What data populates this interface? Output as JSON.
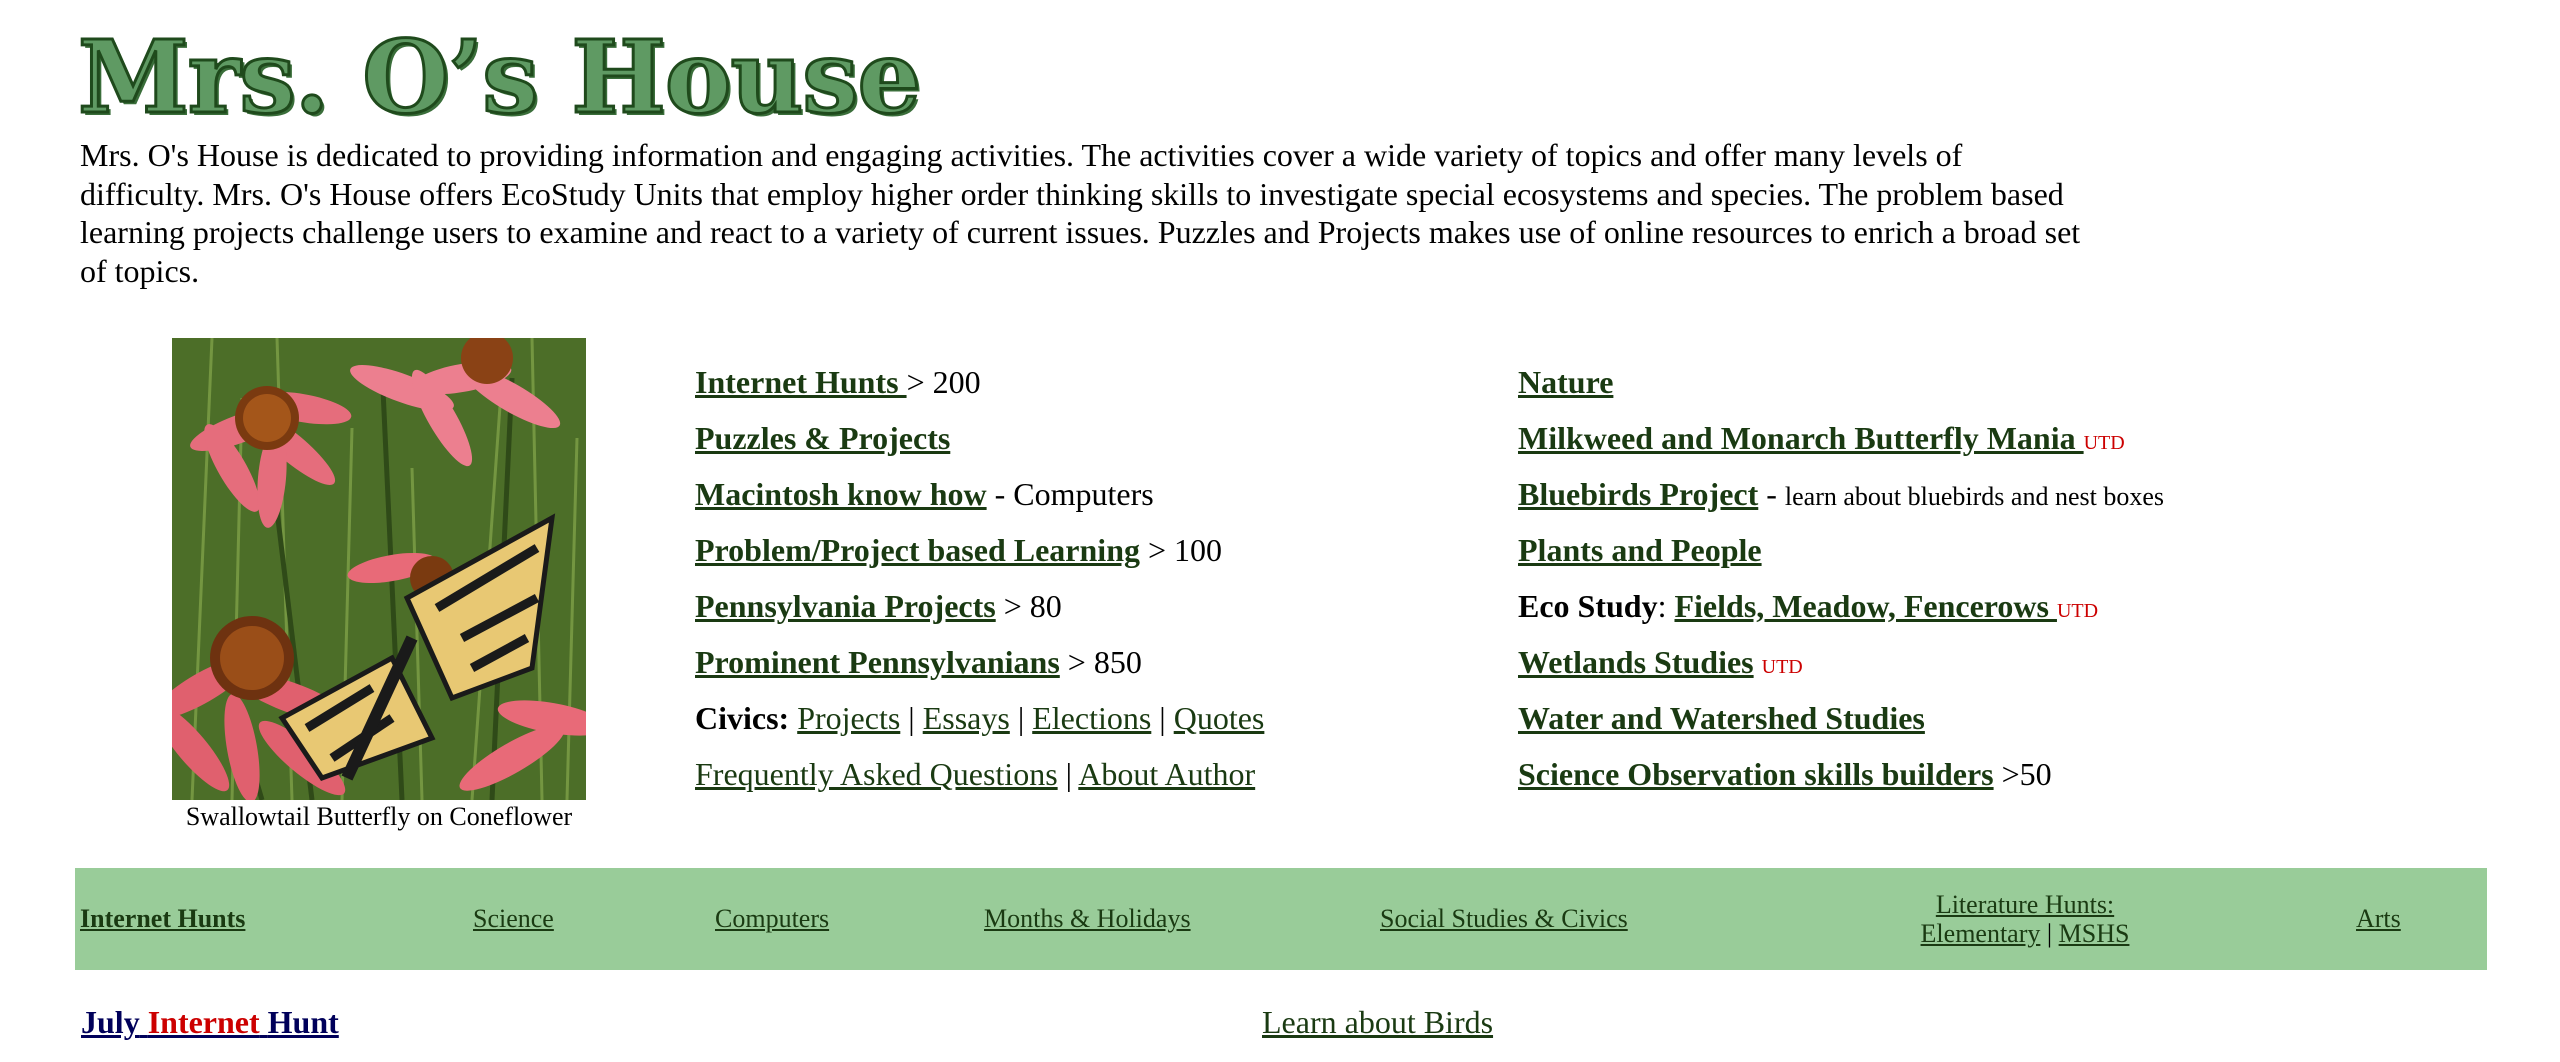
{
  "header": {
    "logo_text": "Mrs. O’s House",
    "intro": "Mrs. O's House is dedicated to providing information and engaging activities. The activities cover a wide variety of topics and offer many levels of difficulty. Mrs. O's House offers EcoStudy Units that employ higher order thinking skills to investigate special ecosystems and species. The problem based learning projects challenge users to examine and react to a variety of current issues. Puzzles and Projects makes use of online resources to enrich a broad set of topics."
  },
  "photo": {
    "caption": "Swallowtail Butterfly on Coneflower"
  },
  "col1": {
    "internet_hunts": "Internet Hunts ",
    "internet_hunts_count": " > 200",
    "puzzles": "Puzzles & Projects",
    "mac": "Macintosh know how",
    "mac_suffix": " - Computers",
    "pbl": "Problem/Project based Learning",
    "pbl_count": " > 100",
    "pa_projects": "Pennsylvania Projects",
    "pa_projects_count": " > 80",
    "prominent": "Prominent Pennsylvanians",
    "prominent_count": " > 850",
    "civics_label": "Civics:",
    "civics_projects": "Projects",
    "civics_essays": "Essays",
    "civics_elections": "Elections",
    "civics_quotes": "Quotes",
    "sep": " | ",
    "faq": "Frequently Asked Questions",
    "about": "About Author"
  },
  "col2": {
    "nature": "Nature",
    "milkweed": "Milkweed and Monarch Butterfly Mania ",
    "utd": "UTD",
    "bluebirds": "Bluebirds Project",
    "bluebirds_dash": " - ",
    "bluebirds_desc": "learn about bluebirds and nest boxes",
    "plants": "Plants and People",
    "eco_study": "Eco Study",
    "colon": ": ",
    "fields": "Fields, Meadow, Fencerows ",
    "wetlands": "Wetlands Studies",
    "water": "Water and Watershed Studies",
    "science_obs": "Science Observation skills builders",
    "science_obs_count": " >50"
  },
  "navbar": {
    "internet_hunts": "Internet Hunts",
    "science": "Science",
    "computers": "Computers",
    "months": "Months & Holidays",
    "social": "Social Studies & Civics",
    "lit_label": "Literature Hunts:",
    "lit_elementary": "Elementary",
    "lit_sep": " | ",
    "lit_mshs": "MSHS",
    "arts": "Arts"
  },
  "footer": {
    "july": "July",
    "internet": "Internet",
    "hunt": "Hunt",
    "birds": "Learn about Birds"
  },
  "colors": {
    "link": "#1a3a12",
    "navbar_bg": "#99cc99",
    "utd": "#cc0000",
    "navy": "#00005a"
  }
}
